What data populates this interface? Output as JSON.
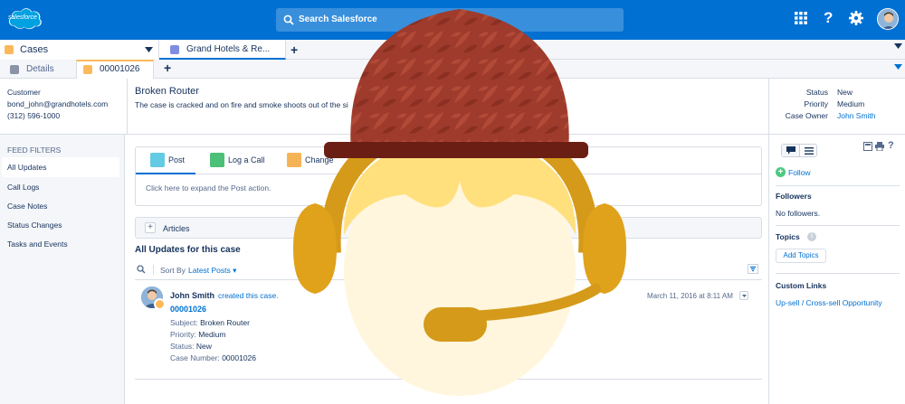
{
  "header": {
    "logo_text": "salesforce",
    "search_placeholder": "Search Salesforce",
    "icons": [
      "apps-grid-icon",
      "help-icon",
      "settings-gear-icon"
    ],
    "colors": {
      "brand": "#0070d2"
    }
  },
  "workspace_tabs": {
    "primary_label": "Cases",
    "active_label": "Grand Hotels & Re..."
  },
  "subtabs": {
    "details_label": "Details",
    "case_label": "00001026"
  },
  "case": {
    "customer_label": "Customer",
    "email": "bond_john@grandhotels.com",
    "phone": "(312) 596-1000",
    "subject": "Broken Router",
    "description": "The case is cracked and on fire and smoke shoots out of the si",
    "status_label": "Status",
    "status_value": "New",
    "priority_label": "Priority",
    "priority_value": "Medium",
    "owner_label": "Case Owner",
    "owner_value": "John Smith"
  },
  "feed_filters": {
    "heading": "FEED FILTERS",
    "items": [
      "All Updates",
      "Call Logs",
      "Case Notes",
      "Status Changes",
      "Tasks and Events"
    ]
  },
  "publisher": {
    "tabs": [
      "Post",
      "Log a Call",
      "Change"
    ],
    "expand_text": "Click here to expand the Post action."
  },
  "articles_label": "Articles",
  "feed": {
    "heading": "All Updates for this case",
    "sort_by_label": "Sort By",
    "sort_value": "Latest Posts",
    "post": {
      "author": "John Smith",
      "action": "created this case.",
      "case_number_link": "00001026",
      "date": "March 11, 2016 at 8:11 AM",
      "fields": [
        {
          "key": "Subject:",
          "value": "Broken Router"
        },
        {
          "key": "Priority:",
          "value": "Medium"
        },
        {
          "key": "Status:",
          "value": "New"
        },
        {
          "key": "Case Number:",
          "value": "00001026"
        }
      ]
    }
  },
  "right_sidebar": {
    "follow_label": "Follow",
    "followers_heading": "Followers",
    "followers_text": "No followers.",
    "topics_heading": "Topics",
    "add_topics_label": "Add Topics",
    "custom_links_heading": "Custom Links",
    "custom_link_1": "Up-sell",
    "custom_link_sep": " / ",
    "custom_link_2": "Cross-sell Opportunity"
  }
}
